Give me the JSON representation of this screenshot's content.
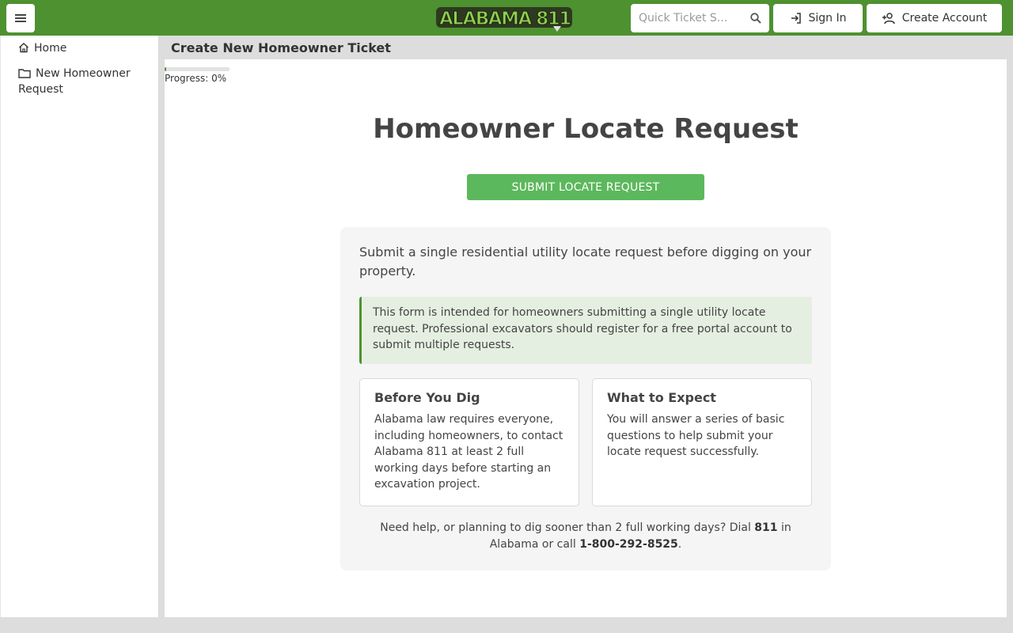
{
  "header": {
    "search_placeholder": "Quick Ticket S...",
    "signin_label": "Sign In",
    "create_account_label": "Create Account",
    "logo_text": "ALABAMA 811",
    "brand_color": "#4e9130"
  },
  "sidebar": {
    "items": [
      {
        "label": "Home",
        "icon": "home-icon"
      },
      {
        "label": "New Homeowner Request",
        "icon": "folder-icon"
      }
    ]
  },
  "main": {
    "page_title": "Create New Homeowner Ticket",
    "progress": {
      "label": "Progress: 0%",
      "value": 0.03
    },
    "heading": "Homeowner Locate Request",
    "submit_label": "SUBMIT LOCATE REQUEST",
    "intro": "Submit a single residential utility locate request before digging on your property.",
    "notice": "This form is intended for homeowners submitting a single utility locate request. Professional excavators should register for a free portal account to submit multiple requests.",
    "cards": [
      {
        "title": "Before You Dig",
        "body": "Alabama law requires everyone, including homeowners, to contact Alabama 811 at least 2 full working days before starting an excavation project."
      },
      {
        "title": "What to Expect",
        "body": "You will answer a series of basic questions to help submit your locate request successfully."
      }
    ],
    "help": {
      "text_1": "Need help, or planning to dig sooner than 2 full working days? Dial ",
      "dial_number": "811",
      "text_2": " in Alabama or call ",
      "phone": "1-800-292-8525",
      "text_3": "."
    }
  }
}
